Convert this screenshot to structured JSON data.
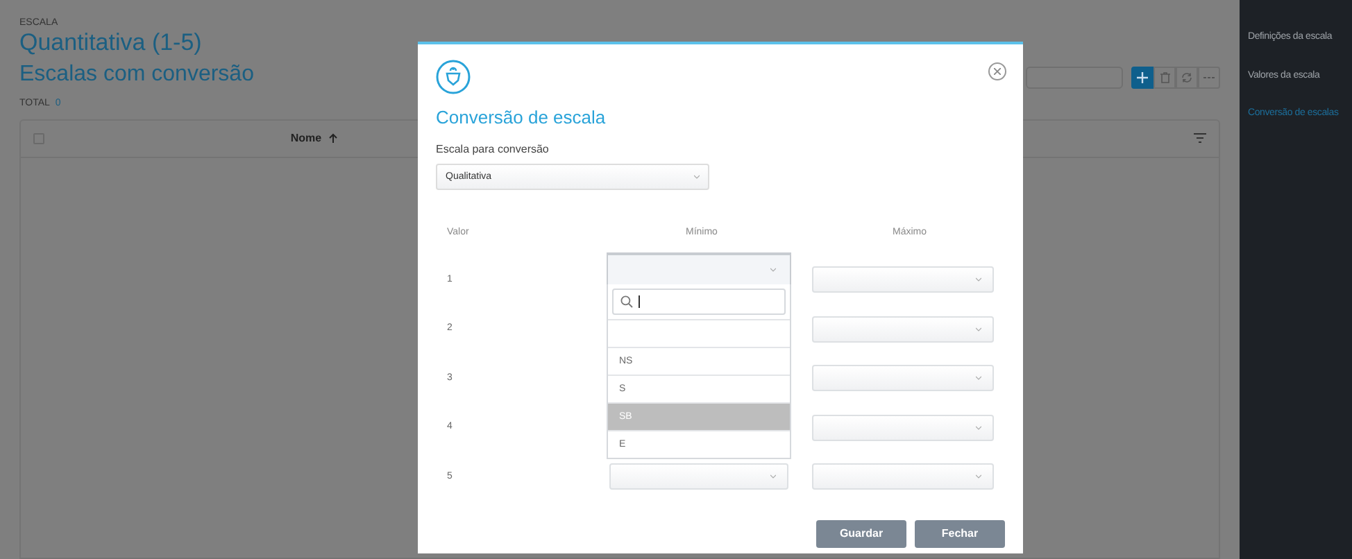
{
  "page": {
    "section_label": "ESCALA",
    "title": "Quantitativa (1-5)",
    "subtitle": "Escalas com conversão",
    "total_label": "TOTAL",
    "total_value": "0",
    "table": {
      "select_all_checked": false,
      "columns": [
        {
          "label": "Nome",
          "sorted": true
        }
      ]
    }
  },
  "sidebar": {
    "items": [
      {
        "label": "Definições da escala",
        "selected": false
      },
      {
        "label": "Valores da escala",
        "selected": false
      },
      {
        "label": "Conversão de escalas",
        "selected": true
      }
    ]
  },
  "modal": {
    "title": "Conversão de escala",
    "field_label": "Escala para conversão",
    "field_value": "Qualitativa",
    "columns": [
      "Valor",
      "Mínimo",
      "Máximo"
    ],
    "rows": [
      {
        "value": "1",
        "min": {
          "open": true
        }
      },
      {
        "value": "2"
      },
      {
        "value": "3"
      },
      {
        "value": "4"
      },
      {
        "value": "5",
        "min": {
          "open": false
        }
      }
    ],
    "dropdown": {
      "options": [
        {
          "kind": "blank",
          "selected": false
        },
        {
          "kind": "option",
          "label": "NS",
          "selected": false
        },
        {
          "kind": "option",
          "label": "S",
          "selected": false
        },
        {
          "kind": "option",
          "label": "SB",
          "selected": true
        },
        {
          "kind": "option",
          "label": "E",
          "selected": false
        }
      ]
    },
    "buttons": [
      "Guardar",
      "Fechar"
    ]
  }
}
